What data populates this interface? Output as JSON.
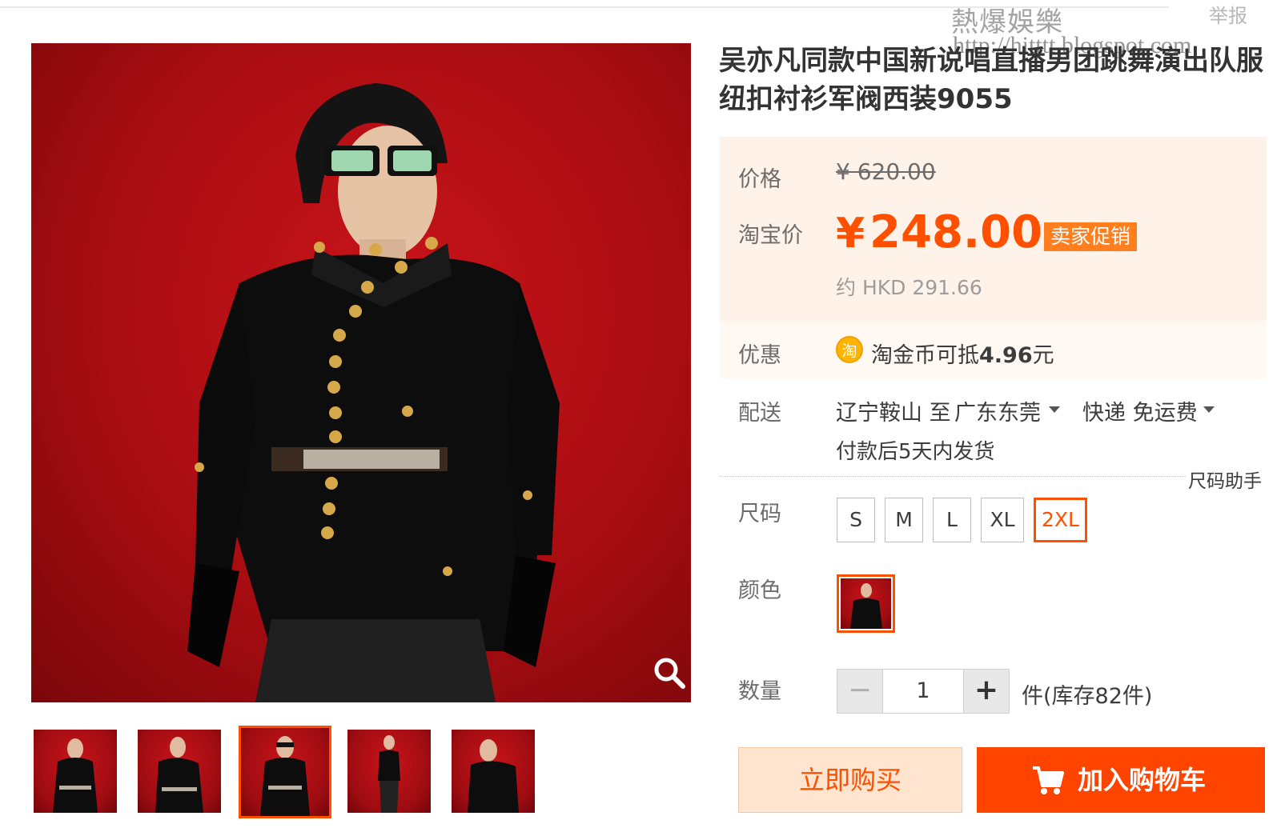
{
  "header": {
    "report_label": "举报",
    "watermark_title": "熱爆娛樂",
    "watermark_url": "http://hitttt.blogspot.com"
  },
  "product": {
    "title": "吴亦凡同款中国新说唱直播男团跳舞演出队服纽扣衬衫军阀西装9055"
  },
  "price": {
    "label": "价格",
    "original": "¥ 620.00",
    "taobao_label": "淘宝价",
    "currency_symbol": "¥",
    "current": "248.00",
    "promo_badge": "卖家促销",
    "hkd": "约 HKD 291.66",
    "accent_color": "#ff5000"
  },
  "promotion": {
    "label": "优惠",
    "coin_icon": "淘",
    "coin_text_prefix": "淘金币可抵",
    "coin_amount": "4.96",
    "coin_text_suffix": "元"
  },
  "delivery": {
    "label": "配送",
    "from": "辽宁鞍山 至",
    "to": "广东东莞",
    "method": "快递 免运费",
    "ship_time": "付款后5天内发货"
  },
  "size": {
    "label": "尺码",
    "helper": "尺码助手",
    "options": [
      "S",
      "M",
      "L",
      "XL",
      "2XL"
    ],
    "selected": "2XL"
  },
  "color": {
    "label": "颜色"
  },
  "quantity": {
    "label": "数量",
    "minus": "−",
    "value": "1",
    "plus": "+",
    "stock": "件(库存82件)"
  },
  "actions": {
    "buy_now": "立即购买",
    "add_cart": "加入购物车"
  },
  "icons": {
    "zoom": "magnifier-icon",
    "cart": "shopping-cart-icon"
  }
}
